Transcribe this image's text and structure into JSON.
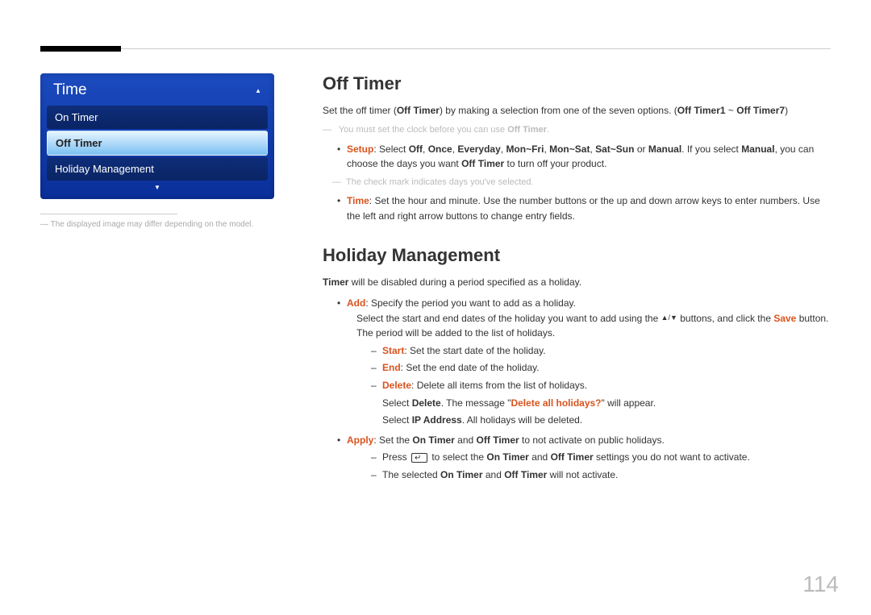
{
  "menu": {
    "title": "Time",
    "items": [
      {
        "label": "On Timer",
        "selected": false
      },
      {
        "label": "Off Timer",
        "selected": true
      },
      {
        "label": "Holiday Management",
        "selected": false
      }
    ]
  },
  "left_note_prefix": "―",
  "left_note": "The displayed image may differ depending on the model.",
  "off_timer": {
    "heading": "Off Timer",
    "intro_pre": "Set the off timer (",
    "intro_bold1": "Off Timer",
    "intro_mid": ") by making a selection from one of the seven options. (",
    "intro_bold2": "Off Timer1",
    "intro_tilde": " ~ ",
    "intro_bold3": "Off Timer7",
    "intro_post": ")",
    "note1_pre": "You must set the clock before you can use ",
    "note1_bold": "Off Timer",
    "note1_post": ".",
    "setup": {
      "label": "Setup",
      "text1": ": Select ",
      "off": "Off",
      "comma1": ", ",
      "once": "Once",
      "comma2": ", ",
      "everyday": "Everyday",
      "comma3": ", ",
      "monfri": "Mon~Fri",
      "comma4": ", ",
      "monsat": "Mon~Sat",
      "comma5": ", ",
      "satsun": "Sat~Sun",
      "or": " or ",
      "manual": "Manual",
      "text2": ". If you select ",
      "manual2": "Manual",
      "text3": ", you can choose the days you want ",
      "offtimer": "Off Timer",
      "text4": " to turn off your product."
    },
    "note2": "The check mark indicates days you've selected.",
    "time": {
      "label": "Time",
      "text": ": Set the hour and minute. Use the number buttons or the up and down arrow keys to enter numbers. Use the left and right arrow buttons to change entry fields."
    }
  },
  "holiday": {
    "heading": "Holiday Management",
    "intro_bold": "Timer",
    "intro_rest": " will be disabled during a period specified as a holiday.",
    "add": {
      "label": "Add",
      "text": ": Specify the period you want to add as a holiday.",
      "line2_pre": "Select the start and end dates of the holiday you want to add using the ",
      "line2_post": " buttons, and click the ",
      "save": "Save",
      "line2_end": " button.",
      "line3": "The period will be added to the list of holidays.",
      "start_lbl": "Start",
      "start_txt": ": Set the start date of the holiday.",
      "end_lbl": "End",
      "end_txt": ": Set the end date of the holiday.",
      "del_lbl": "Delete",
      "del_txt": ": Delete all items from the list of holidays.",
      "del_line2_pre": "Select ",
      "del_line2_b1": "Delete",
      "del_line2_mid": ". The message \"",
      "del_line2_b2": "Delete all holidays?",
      "del_line2_post": "\" will appear.",
      "del_line3_pre": "Select ",
      "del_line3_b": "IP Address",
      "del_line3_post": ". All holidays will be deleted."
    },
    "apply": {
      "label": "Apply",
      "text_pre": ": Set the ",
      "on": "On Timer",
      "and": " and ",
      "off": "Off Timer",
      "text_post": " to not activate on public holidays.",
      "sub1_pre": "Press ",
      "sub1_mid": " to select the ",
      "sub1_on": "On Timer",
      "sub1_and": " and ",
      "sub1_off": "Off Timer",
      "sub1_post": " settings you do not want to activate.",
      "sub2_pre": "The selected ",
      "sub2_on": "On Timer",
      "sub2_and": " and ",
      "sub2_off": "Off Timer",
      "sub2_post": " will not activate."
    }
  },
  "page_number": "114"
}
